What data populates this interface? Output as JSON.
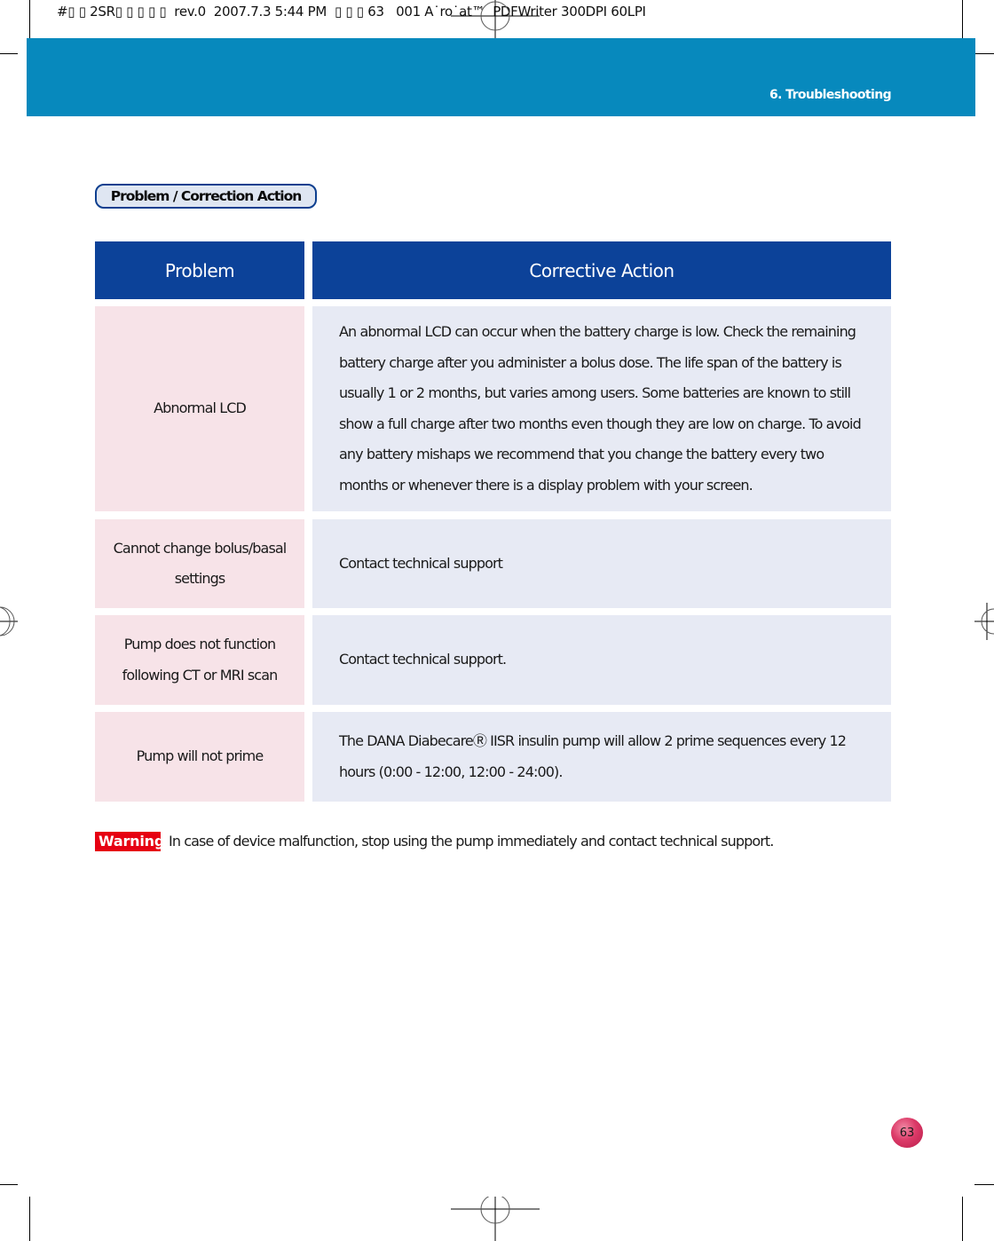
{
  "print_header": {
    "text": "#▯ ▯ 2SR▯ ▯ ▯ ▯ ▯  rev.0  2007.7.3 5:44 PM  ▯ ▯ ▯ 63   001 A˙ro˙at™  PDFWriter 300DPI 60LPI"
  },
  "header": {
    "section_title": "6. Troubleshooting",
    "band_color": "#0789bd"
  },
  "section_pill": {
    "label": "Problem / Correction Action"
  },
  "table": {
    "header_color": "#0c4299",
    "columns": [
      "Problem",
      "Corrective Action"
    ],
    "rows": [
      {
        "problem": "Abnormal LCD",
        "action": "An abnormal LCD can occur when the battery charge is low. Check the remaining battery charge after you administer a bolus dose. The life span of the battery is usually 1 or 2 months, but varies among users. Some batteries are known to still show a full charge after two months even though they are low on charge. To avoid any battery mishaps we recommend that you change the battery every two months or whenever there is a display problem with your screen."
      },
      {
        "problem": "Cannot change bolus/basal settings",
        "action": "Contact technical support"
      },
      {
        "problem": "Pump does not function following CT or MRI scan",
        "action": "Contact technical support."
      },
      {
        "problem": "Pump will not prime",
        "action": "The DANA DiabecareⓇ IISR insulin pump will allow 2 prime sequences every 12 hours (0:00 -  12:00, 12:00 -  24:00)."
      }
    ]
  },
  "warning": {
    "badge": "Warning",
    "badge_color": "#e60012",
    "text": "In case of device malfunction, stop using the pump immediately and contact technical support."
  },
  "page_number": "63"
}
